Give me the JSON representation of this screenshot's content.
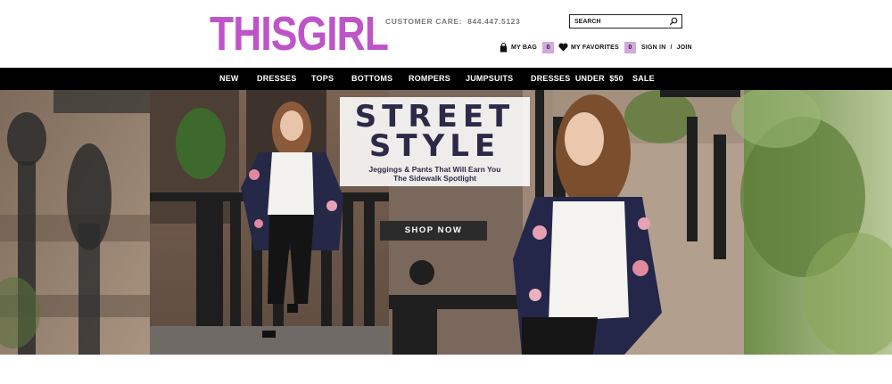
{
  "brand": {
    "logo_text": "THISGIRL",
    "logo_color": "#bf54c9"
  },
  "header": {
    "customer_care_label": "CUSTOMER CARE:",
    "customer_care_phone": "844.447.5123",
    "search_placeholder": "SEARCH",
    "bag_label": "MY BAG",
    "bag_count": "0",
    "favorites_label": "MY FAVORITES",
    "favorites_count": "0",
    "sign_in": "SIGN IN",
    "separator": "/",
    "join": "JOIN"
  },
  "nav": {
    "items": [
      "NEW",
      "DRESSES",
      "TOPS",
      "BOTTOMS",
      "ROMPERS",
      "JUMPSUITS",
      "DRESSES  UNDER  $50",
      "SALE"
    ]
  },
  "hero": {
    "title_line1": "STREET",
    "title_line2": "STYLE",
    "subtitle_line1": "Jeggings & Pants That Will Earn You",
    "subtitle_line2": "The Sidewalk Spotlight",
    "cta": "SHOP NOW"
  },
  "colors": {
    "nav_bg": "#000000",
    "badge_bg": "#d2a8de",
    "title_text": "#2c2a48"
  }
}
